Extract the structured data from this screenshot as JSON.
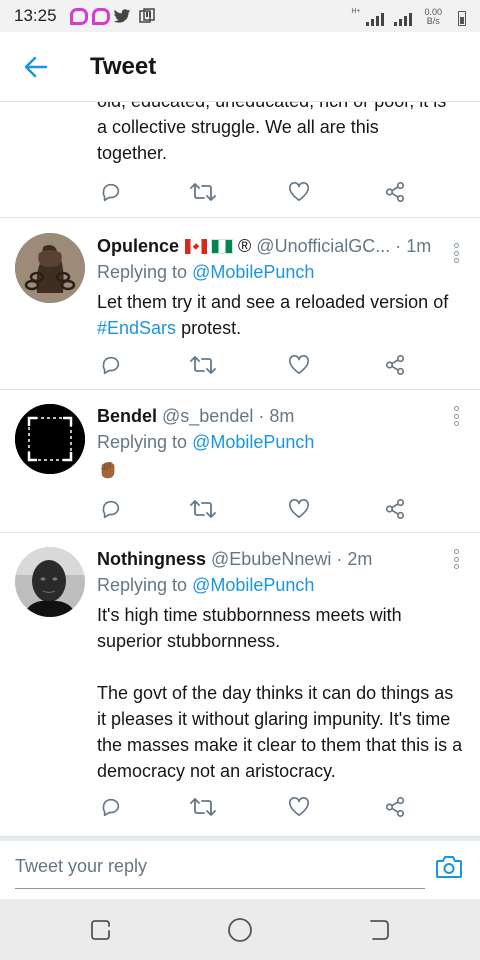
{
  "status_bar": {
    "time": "13:25",
    "network_type": "H+",
    "speed_value": "0.00",
    "speed_unit": "B/s"
  },
  "header": {
    "title": "Tweet",
    "accent_color": "#1b95e0"
  },
  "partial_tweet": {
    "text_line0": "old, educated, uneducated, rich or poor, it is",
    "text_line1": "a collective struggle. We all are this",
    "text_line2": "together."
  },
  "replies": [
    {
      "name": "Opulence",
      "flags": [
        "canada-flag",
        "nigeria-flag"
      ],
      "registered_mark": "®",
      "handle": "@UnofficialGC...",
      "separator": "·",
      "time": "1m",
      "replying_prefix": "Replying to",
      "replying_to": "@MobilePunch",
      "text_before": "Let them try it and see a reloaded version of ",
      "hashtag": "#EndSars",
      "text_after": " protest."
    },
    {
      "name": "Bendel",
      "handle": "@s_bendel",
      "separator": "·",
      "time": "8m",
      "replying_prefix": "Replying to",
      "replying_to": "@MobilePunch",
      "emoji": "raised-fist-emoji"
    },
    {
      "name": "Nothingness",
      "handle": "@EbubeNnewi",
      "separator": "·",
      "time": "2m",
      "replying_prefix": "Replying to",
      "replying_to": "@MobilePunch",
      "text": "It's high time stubbornness meets with superior stubbornness.\n\nThe govt of the day thinks it can do things as it pleases it without glaring impunity. It's time the masses make it clear to them that this is a democracy not an aristocracy."
    }
  ],
  "composer": {
    "placeholder": "Tweet your reply"
  },
  "icons": {
    "reply": "reply-icon",
    "retweet": "retweet-icon",
    "like": "heart-icon",
    "share": "share-icon",
    "more": "more-vertical-icon",
    "camera": "camera-icon"
  }
}
